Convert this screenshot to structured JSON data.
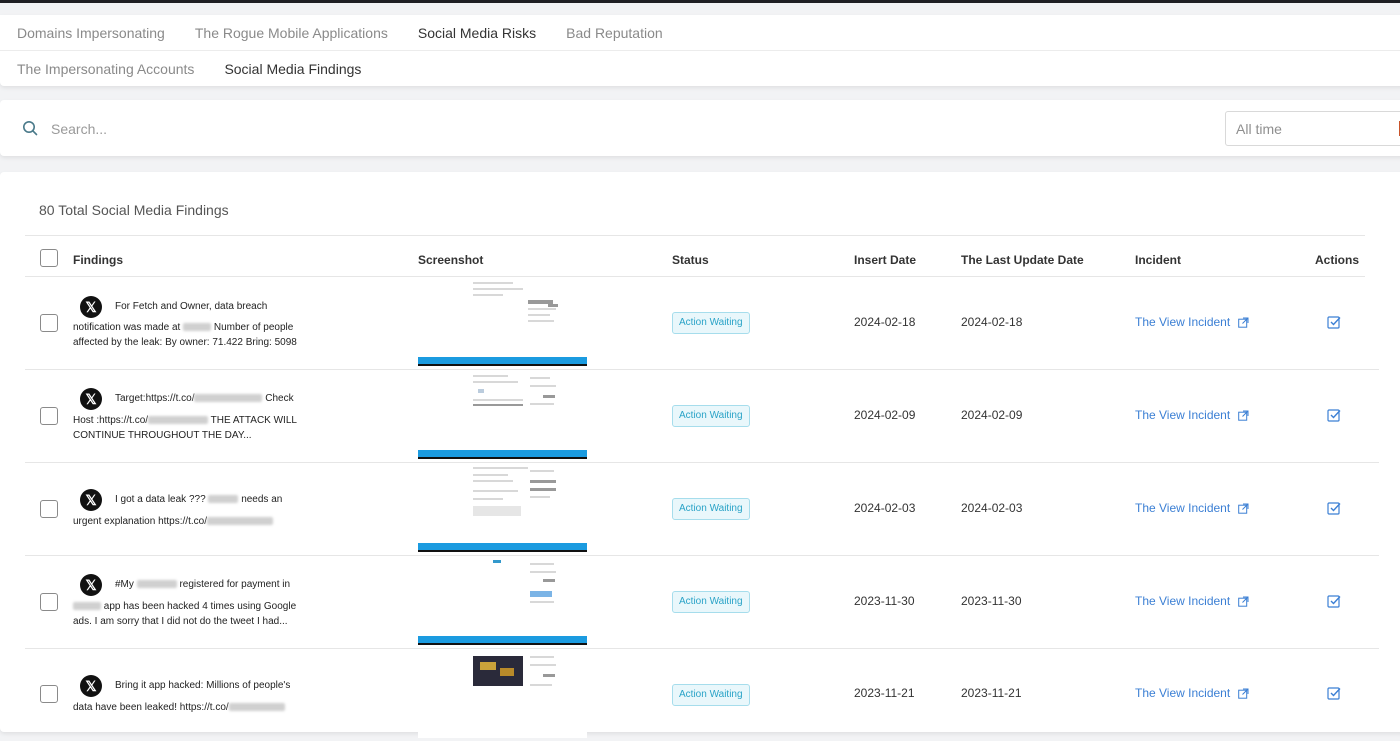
{
  "tabs_row1": [
    {
      "label": "Domains Impersonating",
      "active": false
    },
    {
      "label": "The Rogue Mobile Applications",
      "active": false
    },
    {
      "label": "Social Media Risks",
      "active": true
    },
    {
      "label": "Bad Reputation",
      "active": false
    }
  ],
  "tabs_row2": [
    {
      "label": "The Impersonating Accounts",
      "active": false
    },
    {
      "label": "Social Media Findings",
      "active": true
    }
  ],
  "search": {
    "placeholder": "Search...",
    "time_filter": "All time"
  },
  "table": {
    "total_label": "80 Total Social Media Findings",
    "columns": {
      "findings": "Findings",
      "screenshot": "Screenshot",
      "status": "Status",
      "insert_date": "Insert Date",
      "last_update": "The Last Update Date",
      "incident": "Incident",
      "actions": "Actions"
    },
    "rows": [
      {
        "l1": "For Fetch and Owner, data breach",
        "l2": "notification was made at",
        "l2b": "Number of people",
        "l3": "affected by the leak: By owner: 71.422 Bring: 5098",
        "status": "Action Waiting",
        "insert_date": "2024-02-18",
        "last_update": "2024-02-18",
        "incident": "The View Incident"
      },
      {
        "l1": "Target:https://t.co/",
        "l1b": "Check",
        "l2": "Host :https://t.co/",
        "l2b": "THE ATTACK WILL",
        "l3": "CONTINUE THROUGHOUT THE DAY...",
        "status": "Action Waiting",
        "insert_date": "2024-02-09",
        "last_update": "2024-02-09",
        "incident": "The View Incident"
      },
      {
        "l1": "I got a data leak ???",
        "l1b": "needs an",
        "l2": "urgent explanation https://t.co/",
        "l2b": "",
        "l3": "",
        "status": "Action Waiting",
        "insert_date": "2024-02-03",
        "last_update": "2024-02-03",
        "incident": "The View Incident"
      },
      {
        "l1": "#My",
        "l1b": "registered for payment in",
        "l2": "",
        "l2b": "app has been hacked 4 times using Google",
        "l3": "ads. I am sorry that I did not do the tweet I had...",
        "status": "Action Waiting",
        "insert_date": "2023-11-30",
        "last_update": "2023-11-30",
        "incident": "The View Incident"
      },
      {
        "l1": "Bring it app hacked: Millions of people's",
        "l1b": "",
        "l2": "data have been leaked! https://t.co/",
        "l2b": "",
        "l3": "",
        "status": "Action Waiting",
        "insert_date": "2023-11-21",
        "last_update": "2023-11-21",
        "incident": "The View Incident"
      }
    ]
  },
  "icons": {
    "platform": "x-logo-icon",
    "search": "search-icon",
    "external": "external-link-icon",
    "action": "check-square-icon"
  },
  "colors": {
    "accent": "#3b7fd4",
    "status_text": "#2aa3c7",
    "status_bg": "#e9f7fb"
  }
}
